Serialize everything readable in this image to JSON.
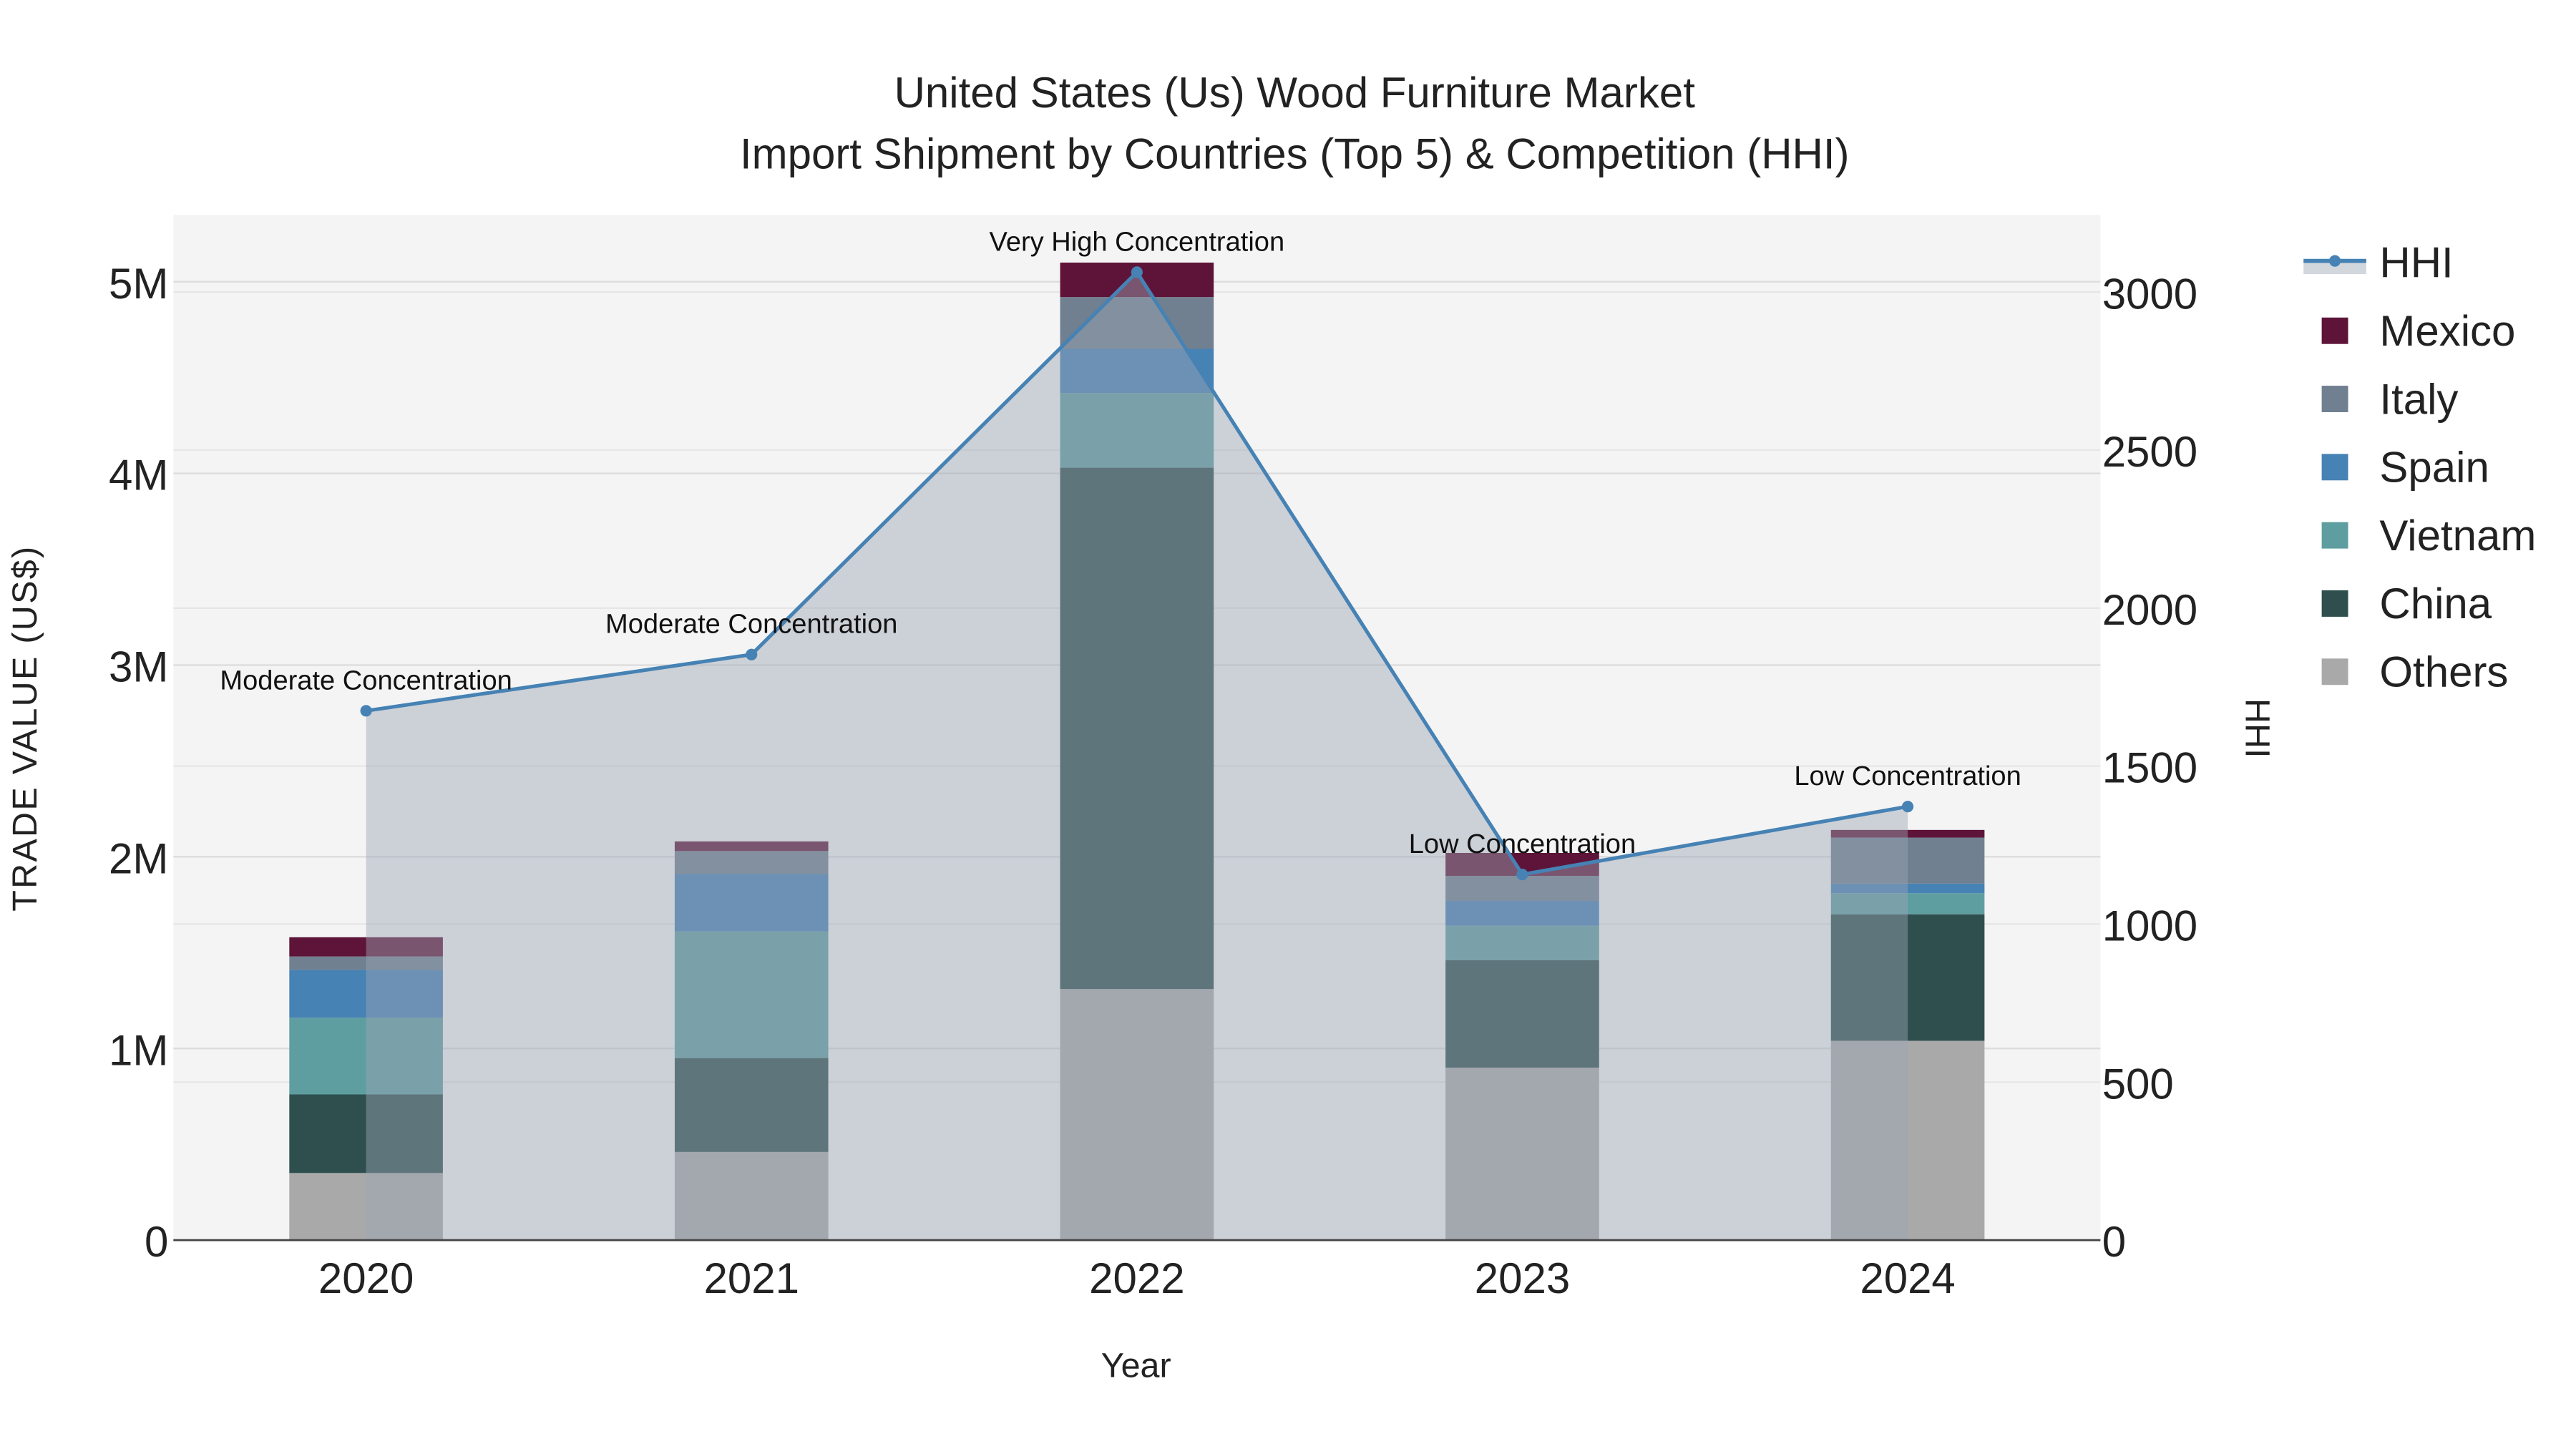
{
  "chart_data": {
    "type": "bar",
    "stacked": true,
    "title": "United States (Us) Wood Furniture Market",
    "subtitle": "Import Shipment by Countries (Top 5) & Competition (HHI)",
    "xlabel": "Year",
    "ylabel": "TRADE VALUE (US$)",
    "y2label": "HHI",
    "categories": [
      "2020",
      "2021",
      "2022",
      "2023",
      "2024"
    ],
    "ylim": [
      0,
      5350000
    ],
    "y2lim": [
      0,
      3245
    ],
    "yticks": [
      {
        "v": 0,
        "label": "0"
      },
      {
        "v": 1000000,
        "label": "1M"
      },
      {
        "v": 2000000,
        "label": "2M"
      },
      {
        "v": 3000000,
        "label": "3M"
      },
      {
        "v": 4000000,
        "label": "4M"
      },
      {
        "v": 5000000,
        "label": "5M"
      }
    ],
    "y2ticks": [
      {
        "v": 0,
        "label": "0"
      },
      {
        "v": 500,
        "label": "500"
      },
      {
        "v": 1000,
        "label": "1000"
      },
      {
        "v": 1500,
        "label": "1500"
      },
      {
        "v": 2000,
        "label": "2000"
      },
      {
        "v": 2500,
        "label": "2500"
      },
      {
        "v": 3000,
        "label": "3000"
      }
    ],
    "series": [
      {
        "name": "Others",
        "color": "#a9a9a9",
        "values": [
          350000,
          460000,
          1310000,
          900000,
          1040000
        ]
      },
      {
        "name": "China",
        "color": "#2f4f4f",
        "values": [
          410000,
          490000,
          2720000,
          560000,
          660000
        ]
      },
      {
        "name": "Vietnam",
        "color": "#5f9ea0",
        "values": [
          400000,
          660000,
          390000,
          180000,
          110000
        ]
      },
      {
        "name": "Spain",
        "color": "#4682b4",
        "values": [
          250000,
          300000,
          230000,
          130000,
          50000
        ]
      },
      {
        "name": "Italy",
        "color": "#708090",
        "values": [
          70000,
          120000,
          270000,
          130000,
          240000
        ]
      },
      {
        "name": "Mexico",
        "color": "#5e1438",
        "values": [
          100000,
          50000,
          180000,
          120000,
          40000
        ]
      }
    ],
    "hhi": {
      "name": "HHI",
      "color": "#4682b4",
      "values": [
        1675,
        1853,
        3063,
        1157,
        1372
      ],
      "annotations": [
        "Moderate Concentration",
        "Moderate Concentration",
        "Very High Concentration",
        "Low Concentration",
        "Low Concentration"
      ]
    },
    "legend": [
      "HHI",
      "Mexico",
      "Italy",
      "Spain",
      "Vietnam",
      "China",
      "Others"
    ],
    "legend_position": "right",
    "grid": true
  }
}
